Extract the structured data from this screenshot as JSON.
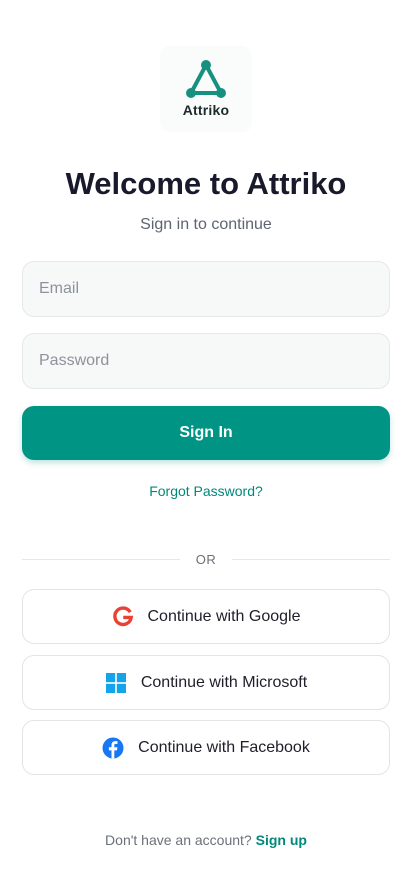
{
  "brand": {
    "name": "Attriko",
    "logo_icon": "triangle-nodes-logo-icon",
    "accent_color": "#009485"
  },
  "header": {
    "title": "Welcome to Attriko",
    "subtitle": "Sign in to continue"
  },
  "form": {
    "email_placeholder": "Email",
    "password_placeholder": "Password",
    "email_value": "",
    "password_value": "",
    "signin_label": "Sign In",
    "forgot_label": "Forgot Password?"
  },
  "divider": {
    "label": "OR"
  },
  "social": {
    "google_label": "Continue with Google",
    "microsoft_label": "Continue with Microsoft",
    "facebook_label": "Continue with Facebook",
    "google_icon": "google-icon",
    "microsoft_icon": "microsoft-icon",
    "facebook_icon": "facebook-icon"
  },
  "footer": {
    "prompt": "Don't have an account?",
    "signup_label": "Sign up"
  }
}
